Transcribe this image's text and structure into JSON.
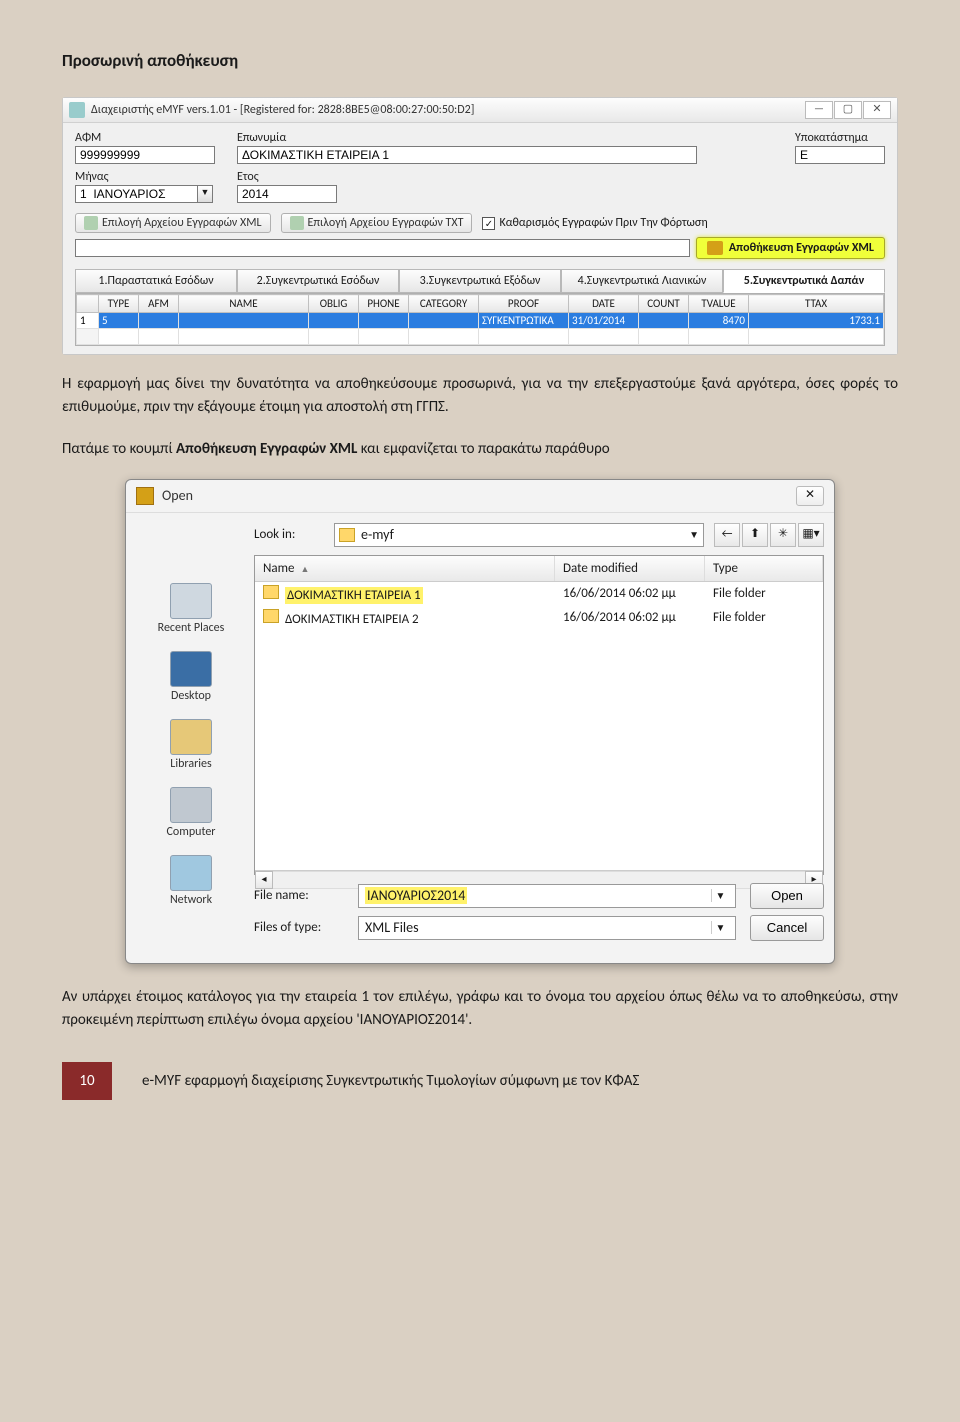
{
  "doc": {
    "heading": "Προσωρινή αποθήκευση",
    "para1": "Η εφαρμογή μας δίνει την δυνατότητα να αποθηκεύσουμε προσωρινά, για να την επεξεργαστούμε ξανά αργότερα, όσες φορές το επιθυμούμε, πριν την εξάγουμε έτοιμη για αποστολή στη ΓΓΠΣ.",
    "para2_prefix": "Πατάμε το κουμπί ",
    "para2_bold": "Αποθήκευση Εγγραφών XML",
    "para2_suffix": " και εμφανίζεται το παρακάτω παράθυρο",
    "para3": "Αν υπάρχει έτοιμος κατάλογος για την εταιρεία 1 τον επιλέγω, γράφω και το όνομα του αρχείου όπως θέλω να το αποθηκεύσω, στην προκειμένη περίπτωση επιλέγω όνομα αρχείου 'ΙΑΝΟΥΑΡΙΟΣ2014'.",
    "page_num": "10",
    "footer": "e-MYF εφαρμογή διαχείρισης Συγκεντρωτικής Τιμολογίων σύμφωνη με τον ΚΦΑΣ"
  },
  "app": {
    "title": "Διαχειριστής eMYF  vers.1.01 - [Registered for: 2828:8BE5@08:00:27:00:50:D2]",
    "fields": {
      "afm_label": "ΑΦΜ",
      "afm_value": "999999999",
      "eponimia_label": "Επωνυμία",
      "eponimia_value": "ΔΟΚΙΜΑΣΤΙΚΗ ΕΤΑΙΡΕΙΑ 1",
      "ypok_label": "Υποκατάστημα",
      "ypok_value": "E",
      "minas_label": "Μήνας",
      "minas_value": "1  ΙΑΝΟΥΑΡΙΟΣ",
      "etos_label": "Ετος",
      "etos_value": "2014"
    },
    "toolbar": {
      "btn_xml": "Επιλογή Αρχείου Εγγραφών XML",
      "btn_txt": "Επιλογή Αρχείου Εγγραφών TXT",
      "chk_clear": "Καθαρισμός Εγγραφών Πριν Την Φόρτωση",
      "save_xml": "Αποθήκευση Εγγραφών XML"
    },
    "tabs": [
      "1.Παραστατικά Εσόδων",
      "2.Συγκεντρωτικά Εσόδων",
      "3.Συγκεντρωτικά Εξόδων",
      "4.Συγκεντρωτικά Λιανικών",
      "5.Συγκεντρωτικά Δαπάν"
    ],
    "active_tab": 4,
    "grid": {
      "headers": [
        "",
        "TYPE",
        "AFM",
        "NAME",
        "OBLIG",
        "PHONE",
        "CATEGORY",
        "PROOF",
        "DATE",
        "COUNT",
        "TVALUE",
        "TTAX"
      ],
      "row": {
        "num": "1",
        "type": "5",
        "category": "",
        "proof": "ΣΥΓΚΕΝΤΡΩΤΙΚΑ",
        "date": "31/01/2014",
        "count": "",
        "tvalue": "8470",
        "ttax": "1733.1"
      }
    }
  },
  "dlg": {
    "title": "Open",
    "lookin_label": "Look in:",
    "lookin_value": "e-myf",
    "places": [
      "Recent Places",
      "Desktop",
      "Libraries",
      "Computer",
      "Network"
    ],
    "cols": {
      "name": "Name",
      "date": "Date modified",
      "type": "Type"
    },
    "rows": [
      {
        "name": "ΔΟΚΙΜΑΣΤΙΚΗ ΕΤΑΙΡΕΙΑ 1",
        "date": "16/06/2014 06:02 μμ",
        "type": "File folder",
        "hl": true
      },
      {
        "name": "ΔΟΚΙΜΑΣΤΙΚΗ ΕΤΑΙΡΕΙΑ 2",
        "date": "16/06/2014 06:02 μμ",
        "type": "File folder",
        "hl": false
      }
    ],
    "filename_label": "File name:",
    "filename_value": "ΙΑΝΟΥΑΡΙΟΣ2014",
    "filetype_label": "Files of type:",
    "filetype_value": "XML Files",
    "open_btn": "Open",
    "cancel_btn": "Cancel"
  }
}
